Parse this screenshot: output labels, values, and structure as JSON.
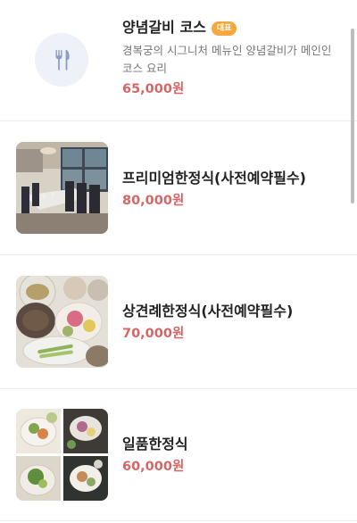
{
  "menu": {
    "items": [
      {
        "name": "양념갈비 코스",
        "badge": "대표",
        "description": "경복궁의 시그니처 메뉴인 양념갈비가 메인인 코스 요리",
        "price": "65,000원",
        "image": "fork-knife-icon"
      },
      {
        "name": "프리미엄한정식(사전예약필수)",
        "price": "80,000원",
        "image": "restaurant-dining-room-photo"
      },
      {
        "name": "상견례한정식(사전예약필수)",
        "price": "70,000원",
        "image": "korean-course-dishes-photo"
      },
      {
        "name": "일품한정식",
        "price": "60,000원",
        "image": "korean-dishes-collage-photo"
      }
    ]
  },
  "colors": {
    "price": "#d66666",
    "badge": "#f7a73b",
    "placeholder_bg": "#eef1f7",
    "icon": "#8e9cc4"
  }
}
